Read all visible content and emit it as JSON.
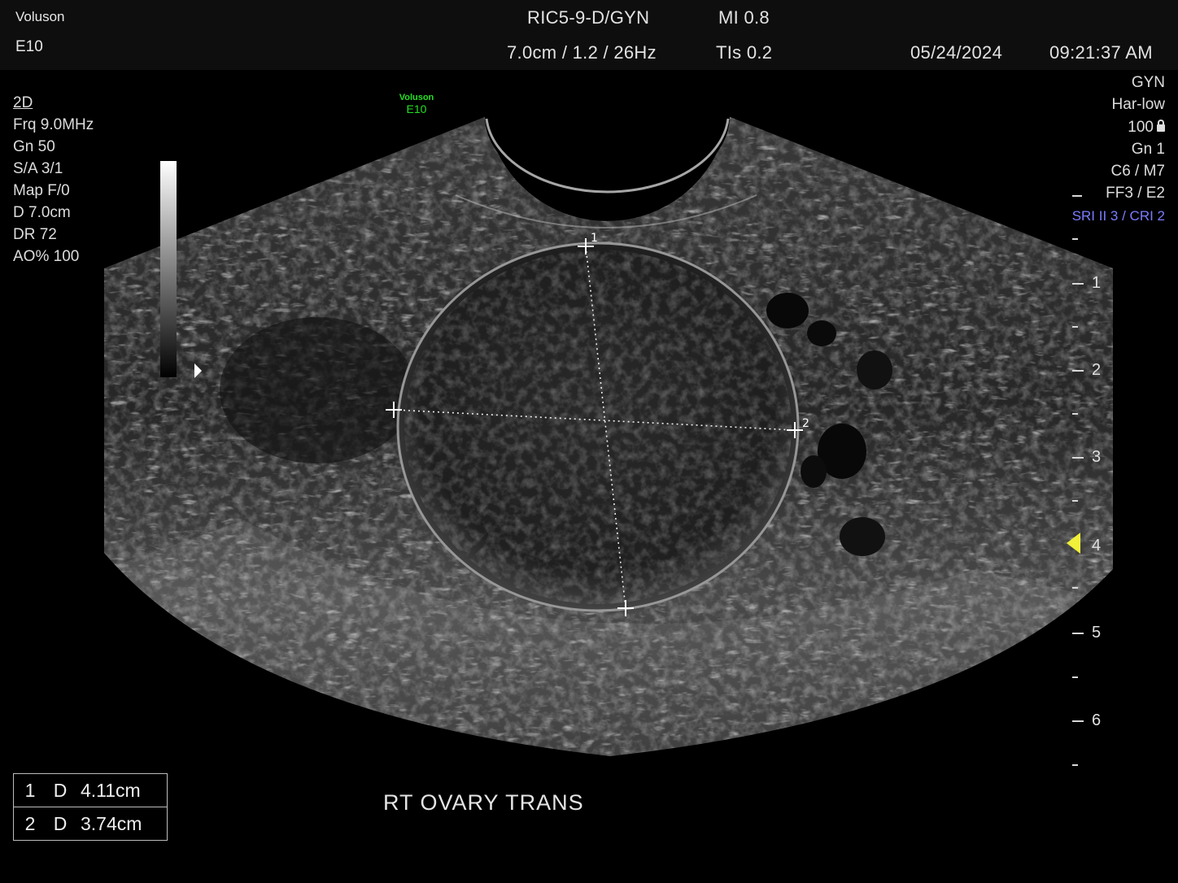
{
  "header": {
    "brand_line1": "Voluson",
    "brand_line2": "E10",
    "probe": "RIC5-9-D/GYN",
    "mi": "MI  0.8",
    "settings": "7.0cm / 1.2 / 26Hz",
    "tis": "TIs  0.2",
    "date": "05/24/2024",
    "time": "09:21:37 AM"
  },
  "left_params": {
    "mode": "2D",
    "items": [
      "Frq  9.0MHz",
      "Gn   50",
      "S/A  3/1",
      "Map  F/0",
      "D    7.0cm",
      "DR  72",
      "AO%  100"
    ]
  },
  "right_params": {
    "items": [
      "GYN",
      "Har-low",
      "100",
      "Gn    1",
      "C6 / M7",
      "FF3 / E2"
    ],
    "sri": "SRI II 3 / CRI 2"
  },
  "logo": {
    "line1": "Voluson",
    "line2": "E10",
    "color": "#22e022"
  },
  "depth_scale": {
    "labels": [
      "1",
      "2",
      "3",
      "4",
      "5",
      "6"
    ],
    "unit": "cm",
    "focus_depth": 4,
    "focus_color": "#f0ef3a"
  },
  "calipers": {
    "c1": "1",
    "c2": "2"
  },
  "measurements": [
    {
      "index": "1",
      "type": "D",
      "value": "4.11cm"
    },
    {
      "index": "2",
      "type": "D",
      "value": "3.74cm"
    }
  ],
  "annotation": "RT  OVARY  TRANS",
  "icons": [
    "lock-icon",
    "greyscale-bar",
    "focus-marker-icon"
  ]
}
